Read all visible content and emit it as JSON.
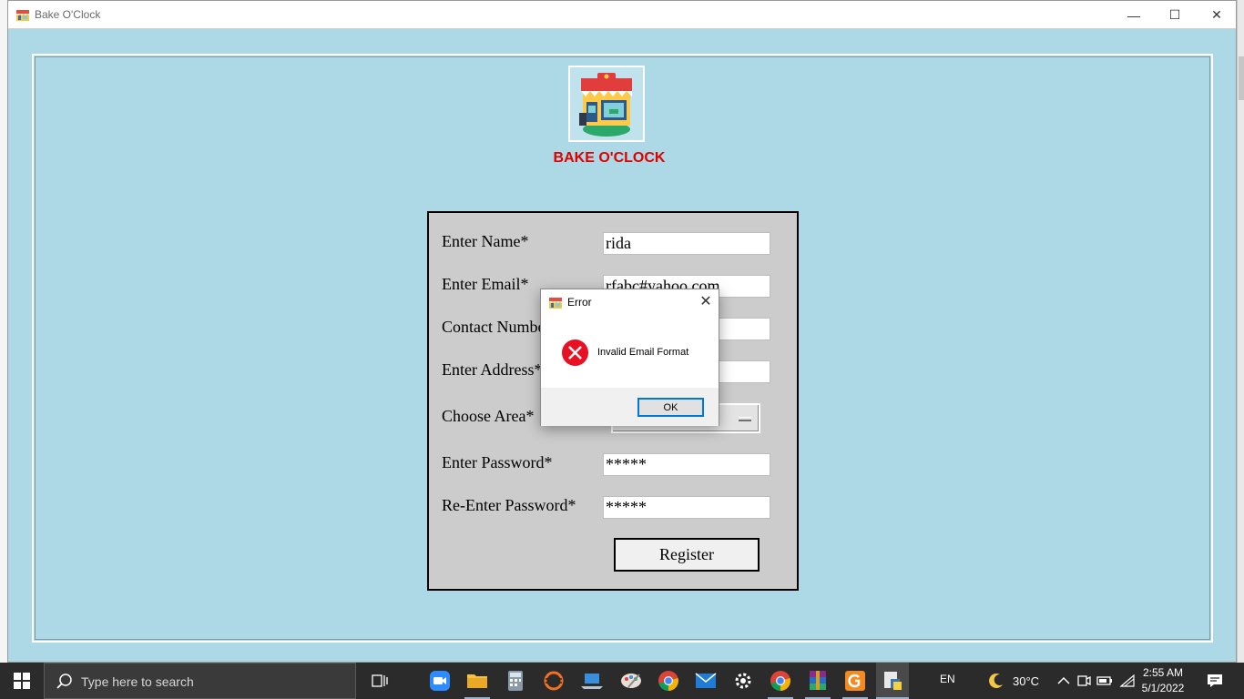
{
  "window": {
    "title": "Bake O'Clock",
    "minimize_glyph": "—",
    "maximize_glyph": "☐",
    "close_glyph": "✕"
  },
  "brand": {
    "name": "BAKE O'CLOCK",
    "logo_icon": "bakery-shop-icon",
    "color": "#e00000"
  },
  "form": {
    "fields": [
      {
        "label": "Enter Name*",
        "value": "rida"
      },
      {
        "label": "Enter Email*",
        "value": "rfabc#yahoo.com"
      },
      {
        "label": "Contact Number*",
        "value": ""
      },
      {
        "label": "Enter Address*",
        "value": ""
      },
      {
        "label": "Choose Area*",
        "value": ""
      },
      {
        "label": "Enter Password*",
        "value": "*****"
      },
      {
        "label": "Re-Enter Password*",
        "value": "*****"
      }
    ],
    "register_label": "Register",
    "background": "#cccccc"
  },
  "dialog": {
    "title": "Error",
    "message": "Invalid Email Format",
    "ok_label": "OK",
    "close_glyph": "✕",
    "icon": "error-icon"
  },
  "taskbar": {
    "search_placeholder": "Type here to search",
    "language": "EN",
    "temperature": "30°C",
    "time": "2:55 AM",
    "date": "5/1/2022"
  },
  "colors": {
    "app_background": "#add8e6",
    "taskbar": "#2b2b2b"
  }
}
